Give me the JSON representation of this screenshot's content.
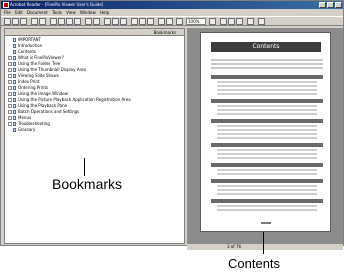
{
  "window": {
    "title": "Acrobat Reader - [FinePix Viewer User's Guide]"
  },
  "menu": [
    "File",
    "Edit",
    "Document",
    "Tools",
    "View",
    "Window",
    "Help"
  ],
  "toolbar": {
    "zoom": "100%"
  },
  "bookmarks_panel": {
    "tab_label": "Bookmarks",
    "items": [
      "IMPORTANT",
      "Introduction",
      "Contents",
      "What is FinePixViewer?",
      "Using the Folder Tree",
      "Using the Thumbnail Display Area",
      "Viewing Slide Shows",
      "Index Print",
      "Ordering Prints",
      "Using the Image Window",
      "Using the Picture Playback Application Registration Area",
      "Using the Playback Pane",
      "Batch Operations and Settings",
      "Menus",
      "Troubleshooting",
      "Glossary"
    ]
  },
  "document": {
    "page_heading": "Contents"
  },
  "status": {
    "page": "3 of 76"
  },
  "annotations": {
    "bookmarks_label": "Bookmarks",
    "contents_label": "Contents"
  }
}
